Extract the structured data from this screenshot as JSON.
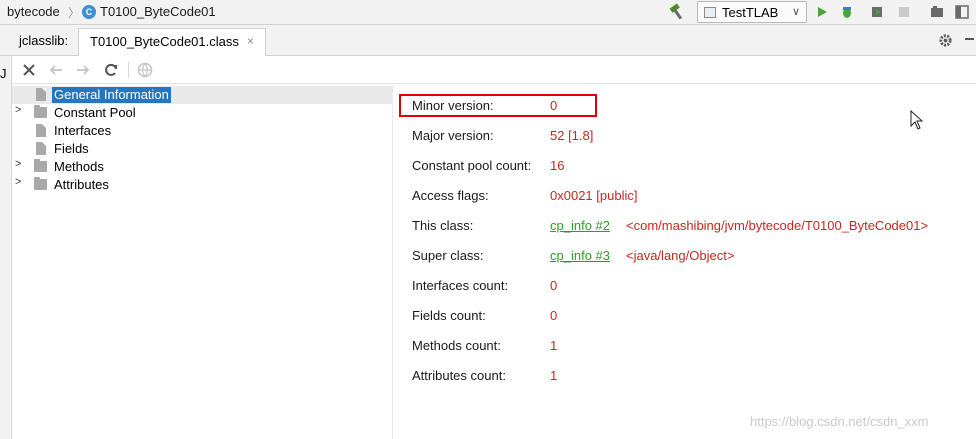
{
  "navbar": {
    "project": "bytecode",
    "class_badge": "C",
    "file": "T0100_ByteCode01",
    "run_config": "TestTLAB",
    "icons": [
      "hammer-icon",
      "run-icon",
      "debug-icon",
      "coverage-icon",
      "stop-icon",
      "build-icon"
    ]
  },
  "toolwindow": {
    "title": "jclasslib:",
    "tab_label": "T0100_ByteCode01.class",
    "tab_close": "×",
    "gutter_char": "J"
  },
  "toolbar": {
    "icons": [
      "close-icon",
      "back-icon",
      "forward-icon",
      "refresh-icon",
      "browser-icon"
    ]
  },
  "tree": {
    "items": [
      {
        "label": "General Information",
        "expandable": false,
        "icon": "file-icon",
        "selected": true
      },
      {
        "label": "Constant Pool",
        "expandable": true,
        "icon": "folder-icon",
        "selected": false
      },
      {
        "label": "Interfaces",
        "expandable": false,
        "icon": "file-icon",
        "selected": false
      },
      {
        "label": "Fields",
        "expandable": false,
        "icon": "file-icon",
        "selected": false
      },
      {
        "label": "Methods",
        "expandable": true,
        "icon": "folder-icon",
        "selected": false
      },
      {
        "label": "Attributes",
        "expandable": true,
        "icon": "folder-icon",
        "selected": false
      }
    ]
  },
  "details": {
    "fields": [
      {
        "label": "Minor version:",
        "value": "0"
      },
      {
        "label": "Major version:",
        "value": "52 [1.8]"
      },
      {
        "label": "Constant pool count:",
        "value": "16"
      },
      {
        "label": "Access flags:",
        "value": "0x0021 [public]"
      },
      {
        "label": "This class:",
        "link": "cp_info #2",
        "ref": "<com/mashibing/jvm/bytecode/T0100_ByteCode01>"
      },
      {
        "label": "Super class:",
        "link": "cp_info #3",
        "ref": "<java/lang/Object>"
      },
      {
        "label": "Interfaces count:",
        "value": "0"
      },
      {
        "label": "Fields count:",
        "value": "0"
      },
      {
        "label": "Methods count:",
        "value": "1"
      },
      {
        "label": "Attributes count:",
        "value": "1"
      }
    ]
  },
  "watermark": "https://blog.csdn.net/csdn_xxm",
  "colors": {
    "selection": "#2675bf",
    "value_red": "#c8271f",
    "link_green": "#2aa02a",
    "highlight_box": "#e1000a"
  }
}
